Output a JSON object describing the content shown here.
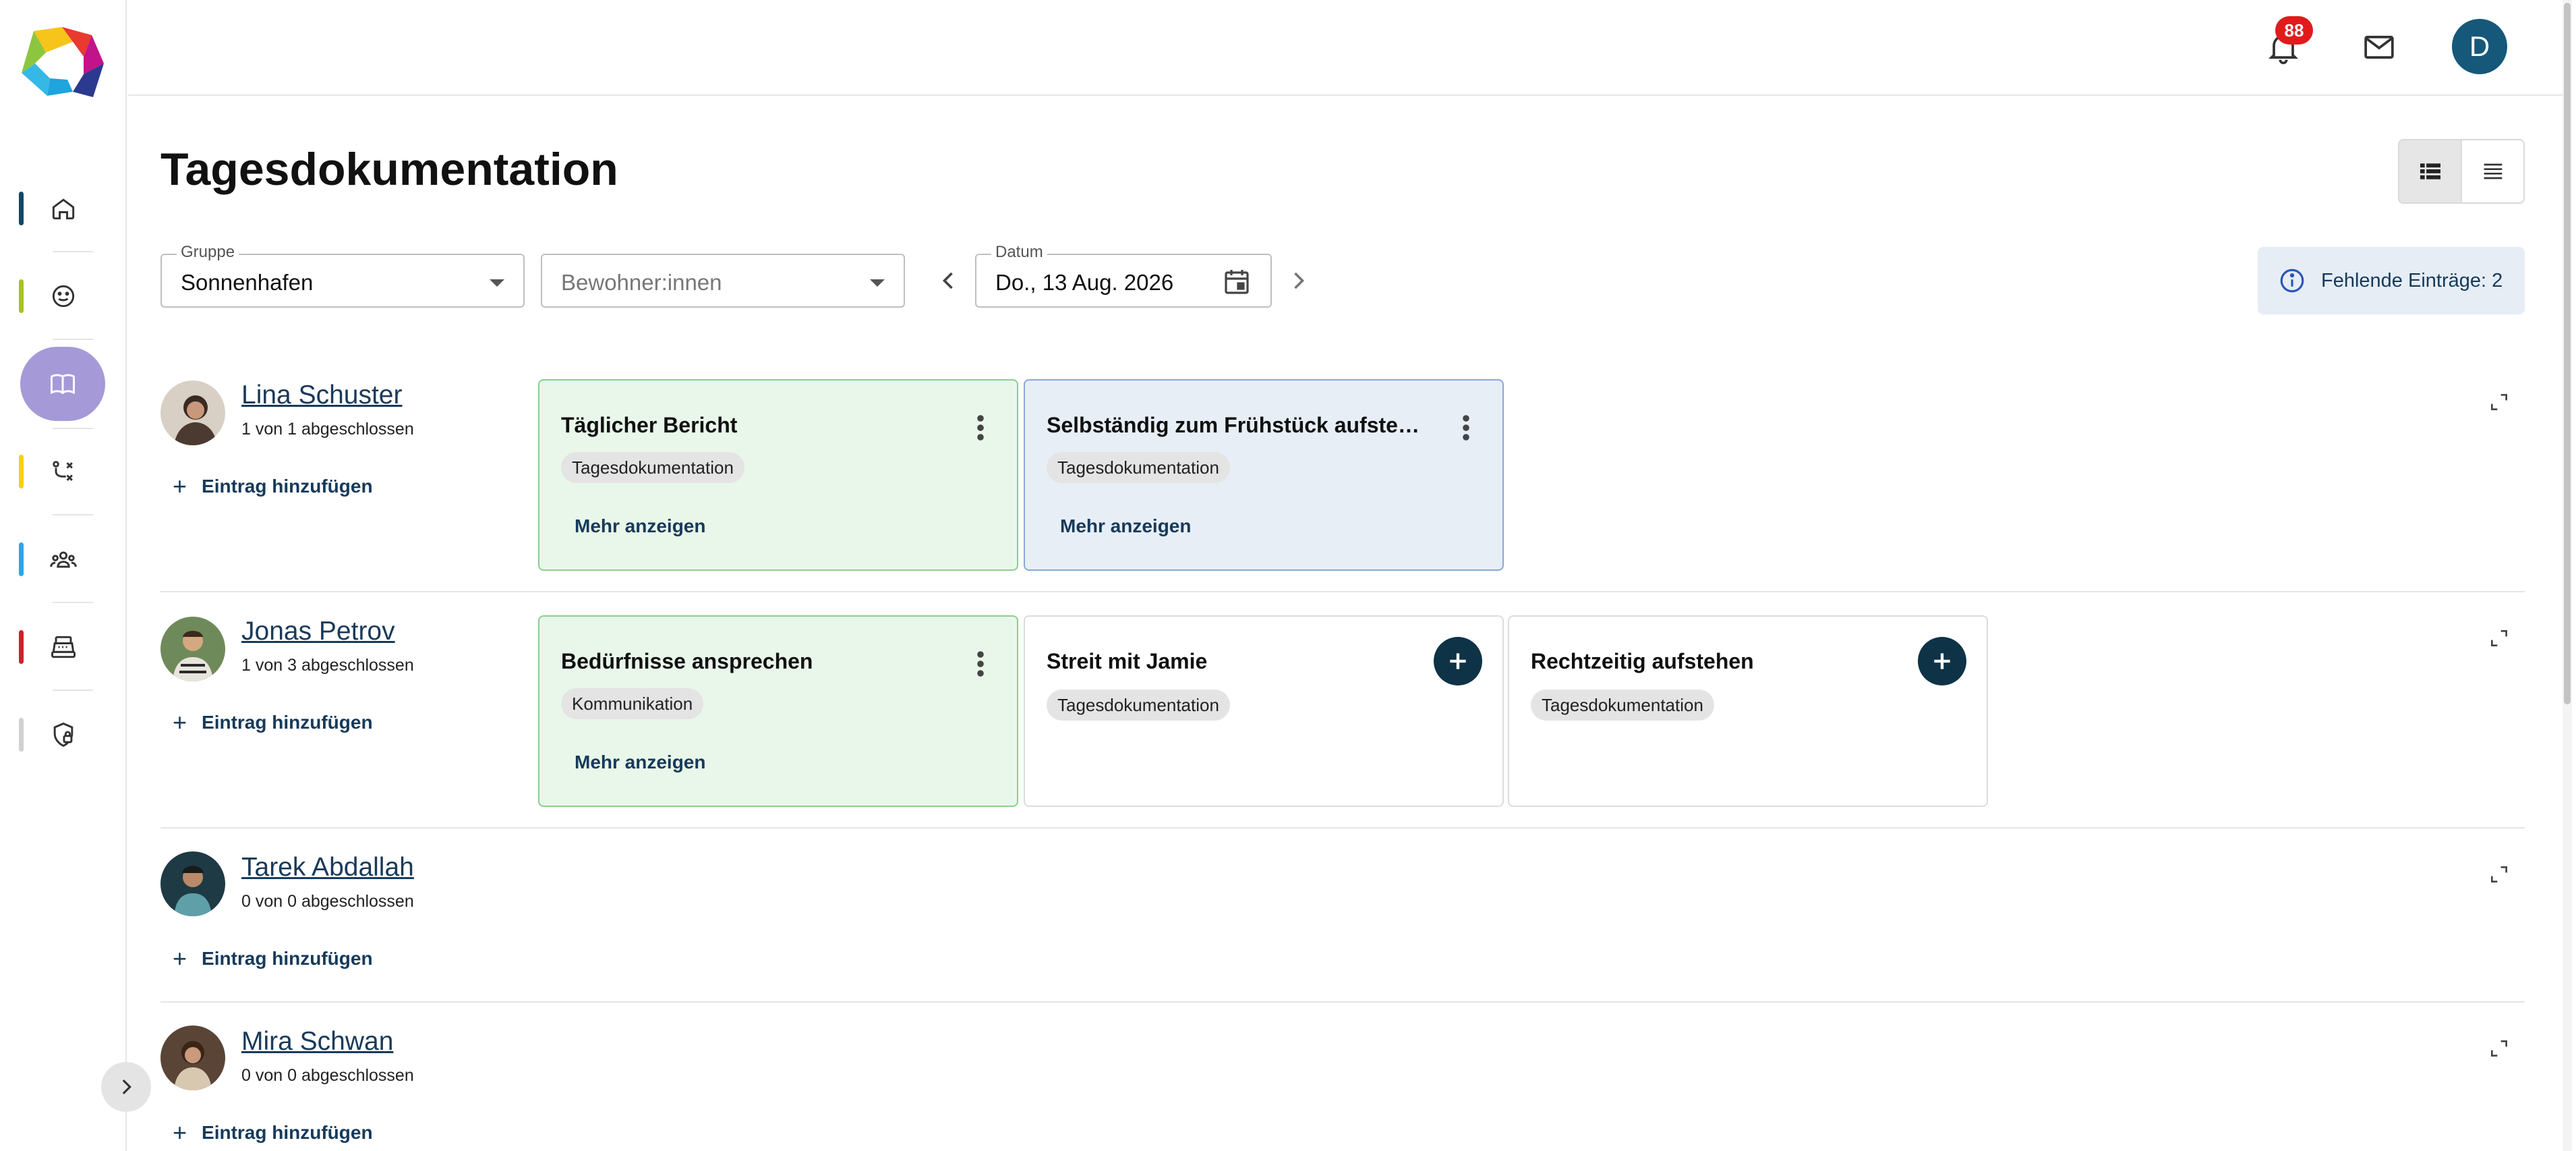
{
  "colors": {
    "accent": "#163a5a",
    "active_nav": "#a59ad7",
    "badge": "#e11b1b",
    "avatar": "#15587a",
    "card_done": "#e9f7ea",
    "card_selected": "#e7eef6"
  },
  "sidebar": {
    "items": [
      {
        "icon": "home-icon",
        "bar_color": "#0f4866"
      },
      {
        "icon": "smiley-icon",
        "bar_color": "#a5c51c"
      },
      {
        "icon": "book-icon",
        "bar_color": "",
        "active": true
      },
      {
        "icon": "shuffle-icon",
        "bar_color": "#f5d20f"
      },
      {
        "icon": "group-icon",
        "bar_color": "#2aa8e0"
      },
      {
        "icon": "cash-register-icon",
        "bar_color": "#d01f2a"
      },
      {
        "icon": "shield-lock-icon",
        "bar_color": "#d0d0d0"
      }
    ]
  },
  "topbar": {
    "notifications_count": "88",
    "user_initial": "D"
  },
  "header": {
    "title": "Tagesdokumentation"
  },
  "filters": {
    "group_label": "Gruppe",
    "group_value": "Sonnenhafen",
    "residents_placeholder": "Bewohner:innen",
    "date_label": "Datum",
    "date_value": "Do., 13 Aug. 2026",
    "missing_entries": "Fehlende Einträge: 2"
  },
  "residents": [
    {
      "name": "Lina Schuster",
      "progress": "1 von 1 abgeschlossen",
      "add_label": "Eintrag hinzufügen",
      "cards": [
        {
          "title": "Täglicher Bericht",
          "tag": "Tagesdokumentation",
          "more": "Mehr anzeigen",
          "state": "done"
        },
        {
          "title": "Selbständig zum Frühstück aufstehen",
          "tag": "Tagesdokumentation",
          "more": "Mehr anzeigen",
          "state": "selected"
        }
      ]
    },
    {
      "name": "Jonas Petrov",
      "progress": "1 von 3 abgeschlossen",
      "add_label": "Eintrag hinzufügen",
      "cards": [
        {
          "title": "Bedürfnisse ansprechen",
          "tag": "Kommunikation",
          "more": "Mehr anzeigen",
          "state": "done"
        },
        {
          "title": "Streit mit Jamie",
          "tag": "Tagesdokumentation",
          "state": "open"
        },
        {
          "title": "Rechtzeitig aufstehen",
          "tag": "Tagesdokumentation",
          "state": "open"
        }
      ]
    },
    {
      "name": "Tarek Abdallah",
      "progress": "0 von 0 abgeschlossen",
      "add_label": "Eintrag hinzufügen",
      "cards": []
    },
    {
      "name": "Mira Schwan",
      "progress": "0 von 0 abgeschlossen",
      "add_label": "Eintrag hinzufügen",
      "cards": []
    }
  ]
}
